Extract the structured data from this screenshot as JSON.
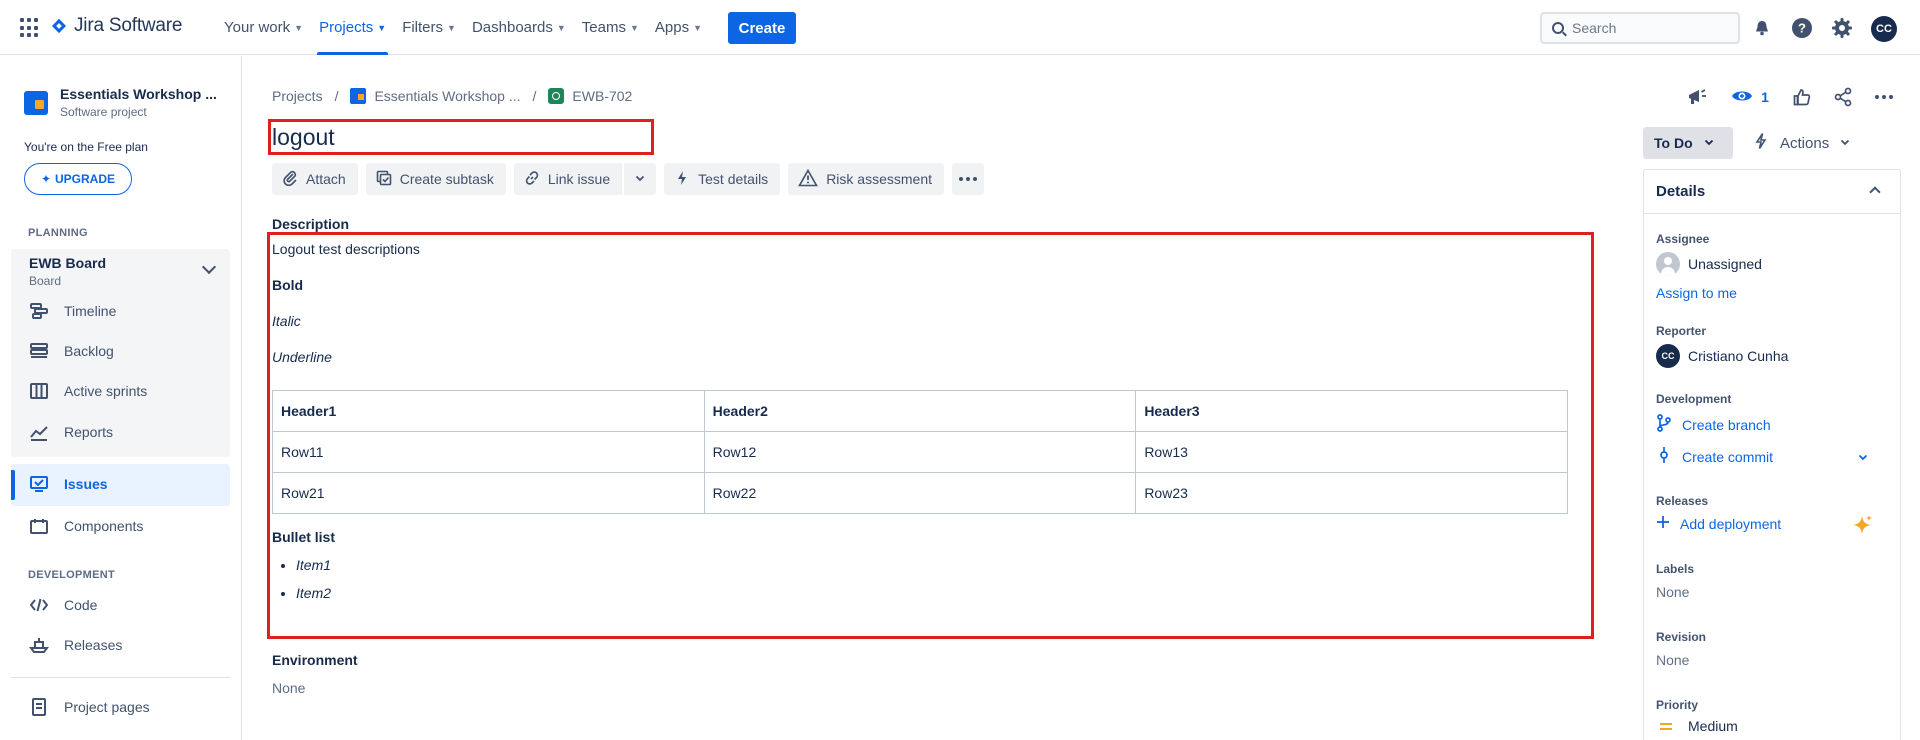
{
  "topnav": {
    "product": "Jira Software",
    "items": [
      {
        "label": "Your work"
      },
      {
        "label": "Projects"
      },
      {
        "label": "Filters"
      },
      {
        "label": "Dashboards"
      },
      {
        "label": "Teams"
      },
      {
        "label": "Apps"
      }
    ],
    "create_label": "Create",
    "search_placeholder": "Search",
    "avatar_initials": "CC"
  },
  "sidebar": {
    "project_name": "Essentials Workshop ...",
    "project_type": "Software project",
    "free_plan": "You're on the Free plan",
    "upgrade_label": "UPGRADE",
    "planning_label": "PLANNING",
    "board_title": "EWB Board",
    "board_sub": "Board",
    "planning_items": [
      "Timeline",
      "Backlog",
      "Active sprints",
      "Reports"
    ],
    "issues_label": "Issues",
    "components_label": "Components",
    "development_label": "DEVELOPMENT",
    "dev_items": [
      "Code",
      "Releases"
    ],
    "project_pages": "Project pages"
  },
  "breadcrumb": {
    "projects": "Projects",
    "project": "Essentials Workshop ...",
    "issue_key": "EWB-702"
  },
  "issue": {
    "title": "logout",
    "toolbar": {
      "attach": "Attach",
      "create_subtask": "Create subtask",
      "link_issue": "Link issue",
      "test_details": "Test details",
      "risk_assessment": "Risk assessment"
    },
    "description_label": "Description",
    "description": {
      "line1": "Logout test descriptions",
      "bold": "Bold",
      "italic": "Italic",
      "underline": "Underline",
      "table": {
        "headers": [
          "Header1",
          "Header2",
          "Header3"
        ],
        "rows": [
          [
            "Row11",
            "Row12",
            "Row13"
          ],
          [
            "Row21",
            "Row22",
            "Row23"
          ]
        ]
      },
      "bullet_heading": "Bullet list",
      "bullets": [
        "Item1",
        "Item2"
      ]
    },
    "environment_label": "Environment",
    "environment_value": "None"
  },
  "right": {
    "watch_count": "1",
    "status": "To Do",
    "actions": "Actions",
    "details_title": "Details",
    "assignee_label": "Assignee",
    "assignee_value": "Unassigned",
    "assign_to_me": "Assign to me",
    "reporter_label": "Reporter",
    "reporter_initials": "CC",
    "reporter_value": "Cristiano Cunha",
    "development_label": "Development",
    "create_branch": "Create branch",
    "create_commit": "Create commit",
    "releases_label": "Releases",
    "add_deployment": "Add deployment",
    "labels_label": "Labels",
    "labels_value": "None",
    "revision_label": "Revision",
    "revision_value": "None",
    "priority_label": "Priority",
    "priority_value": "Medium"
  },
  "colors": {
    "brand": "#0c66e4",
    "highlight": "#e0201c",
    "priority_medium": "#f5a623"
  }
}
